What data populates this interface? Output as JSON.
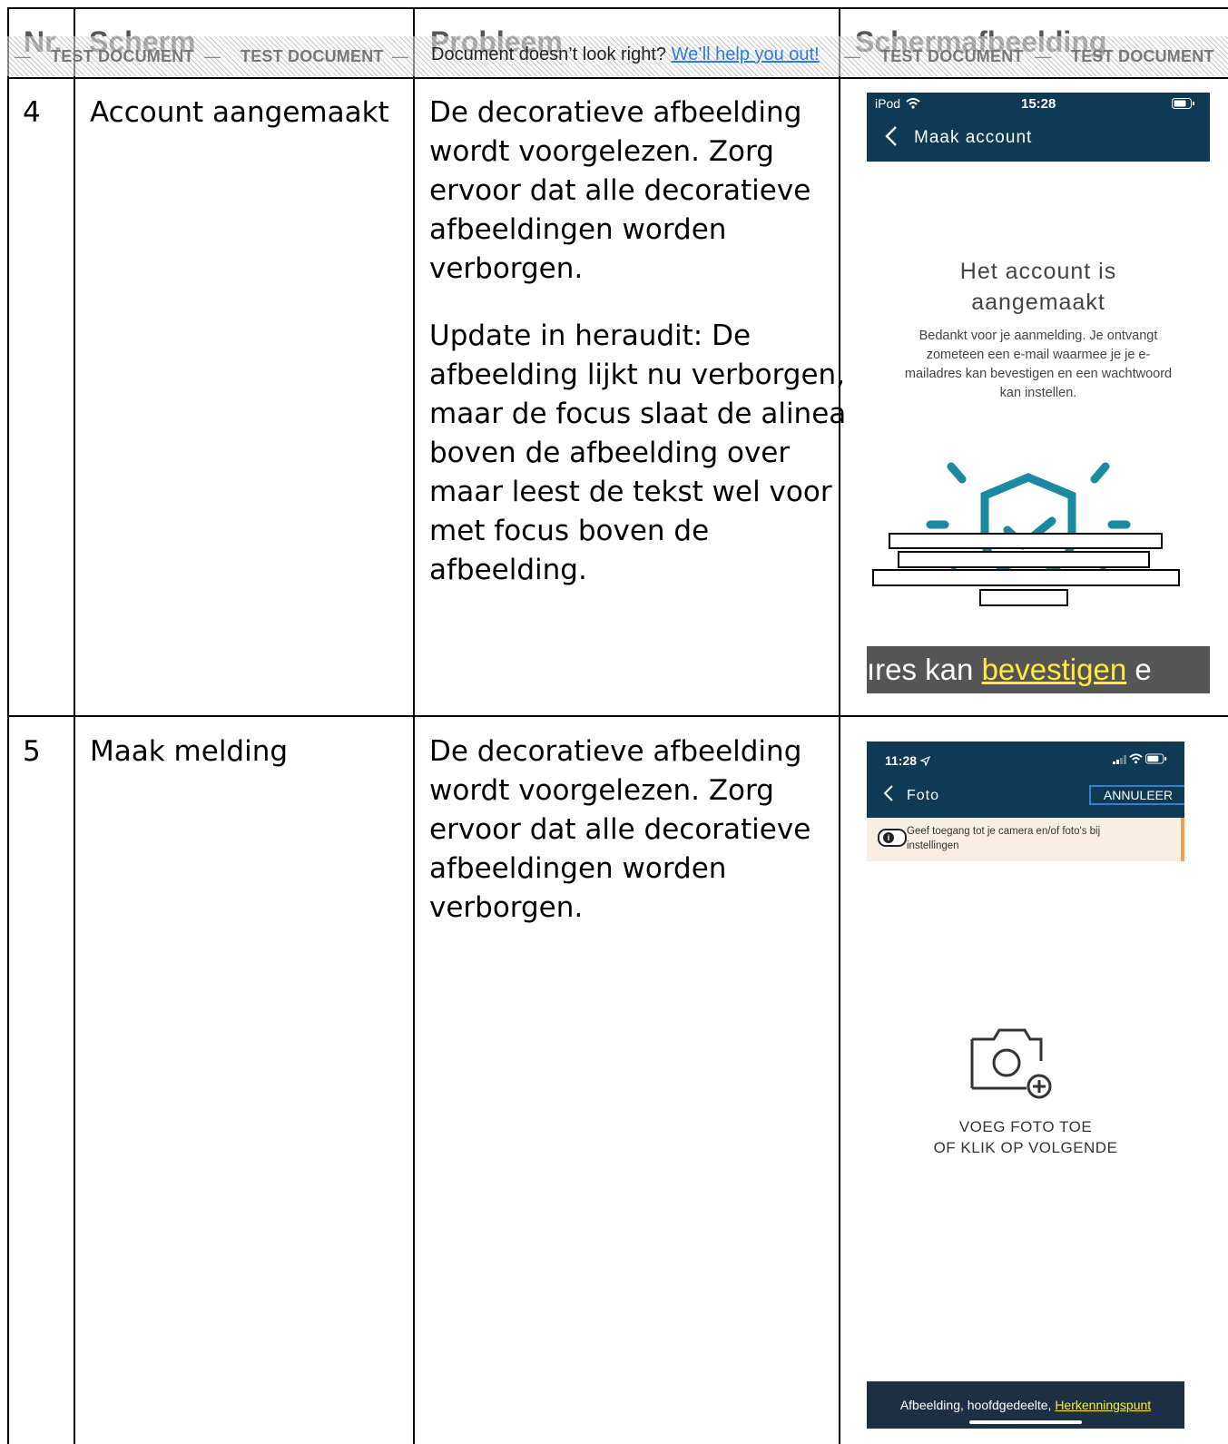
{
  "table": {
    "headers": [
      "Nr.",
      "Scherm",
      "Probleem",
      "Schermafbeelding"
    ],
    "rows": [
      {
        "nr": "4",
        "scherm": "Account aangemaakt",
        "probleem_lines": [
          "De decoratieve afbeelding",
          "wordt voorgelezen. Zorg",
          "ervoor dat alle decoratieve",
          "afbeeldingen worden",
          "verborgen."
        ],
        "update_lines": [
          "Update in heraudit: De",
          "afbeelding lijkt nu verborgen,",
          "maar de focus slaat de alinea",
          "boven de afbeelding over",
          "maar leest de tekst wel voor",
          "met focus boven de",
          "afbeelding."
        ]
      },
      {
        "nr": "5",
        "scherm": "Maak melding",
        "probleem_lines": [
          "De decoratieve afbeelding",
          "wordt voorgelezen. Zorg",
          "ervoor dat alle decoratieve",
          "afbeeldingen worden",
          "verborgen."
        ]
      }
    ]
  },
  "banner": {
    "watermark": "TEST DOCUMENT",
    "dash": "—",
    "message": "Document doesn’t look right?",
    "link": "We’ll help you out!"
  },
  "screenshot1": {
    "status_left": "iPod",
    "time": "15:28",
    "nav_title": "Maak account",
    "heading_lines": [
      "Het account is",
      "aangemaakt"
    ],
    "body_lines": [
      "Bedankt voor je aanmelding. Je ontvangt",
      "zometeen een e-mail waarmee je je e-",
      "mailadres kan bevestigen en een wachtwoord",
      "kan instellen."
    ],
    "caption_before": "ıres kan ",
    "caption_highlight": "bevestigen",
    "caption_after": " e",
    "accent_color": "#1a8aa0",
    "bar_color": "#0e3a53"
  },
  "screenshot2": {
    "time": "11:28",
    "nav_title": "Foto",
    "cancel_label": "ANNULEER",
    "notice_lines": [
      "Geef toegang tot je camera en/of foto's bij",
      "instellingen"
    ],
    "info_glyph": "i",
    "add_lines": [
      "VOEG FOTO TOE",
      "OF KLIK OP VOLGENDE"
    ],
    "caption_before": "Afbeelding, hoofdgedeelte, ",
    "caption_highlight": "Herkenningspunt"
  }
}
